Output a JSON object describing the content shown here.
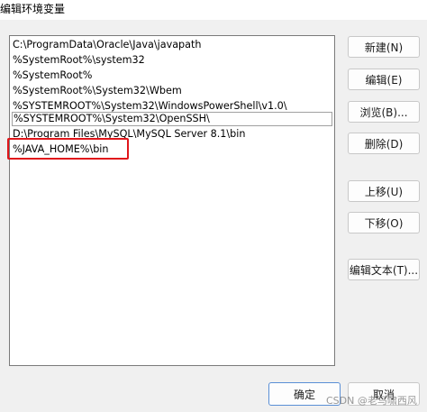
{
  "window": {
    "title": "编辑环境变量"
  },
  "path_list": {
    "items": [
      "C:\\ProgramData\\Oracle\\Java\\javapath",
      "%SystemRoot%\\system32",
      "%SystemRoot%",
      "%SystemRoot%\\System32\\Wbem",
      "%SYSTEMROOT%\\System32\\WindowsPowerShell\\v1.0\\",
      "%SYSTEMROOT%\\System32\\OpenSSH\\",
      "D:\\Program Files\\MySQL\\MySQL Server 8.1\\bin",
      "%JAVA_HOME%\\bin"
    ],
    "selected_index": 5,
    "highlight_color": "#e0161b"
  },
  "buttons": {
    "new": "新建(N)",
    "edit": "编辑(E)",
    "browse": "浏览(B)...",
    "delete": "删除(D)",
    "move_up": "上移(U)",
    "move_down": "下移(O)",
    "edit_text": "编辑文本(T)...",
    "ok": "确定",
    "cancel": "取消"
  },
  "watermark": "CSDN @老马啸西风"
}
